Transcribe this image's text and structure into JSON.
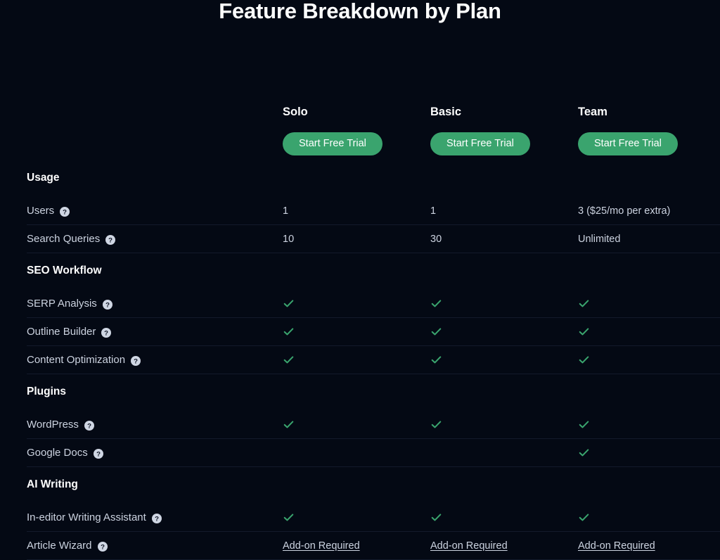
{
  "page": {
    "title": "Feature Breakdown by Plan",
    "background_color": "#040914",
    "accent_green": "#3aa46e",
    "text_color": "#ccd3e0",
    "heading_color": "#ffffff",
    "divider_color": "#131a2b"
  },
  "plans": [
    {
      "name": "Solo",
      "cta_label": "Start Free Trial"
    },
    {
      "name": "Basic",
      "cta_label": "Start Free Trial"
    },
    {
      "name": "Team",
      "cta_label": "Start Free Trial"
    }
  ],
  "help_icon": "question-mark-circle-icon",
  "check_icon": "checkmark-icon",
  "sections": [
    {
      "title": "Usage",
      "rows": [
        {
          "label": "Users",
          "has_help": true,
          "values": [
            {
              "type": "text",
              "text": "1"
            },
            {
              "type": "text",
              "text": "1"
            },
            {
              "type": "text",
              "text": "3 ($25/mo per extra)"
            }
          ]
        },
        {
          "label": "Search Queries",
          "has_help": true,
          "values": [
            {
              "type": "text",
              "text": "10"
            },
            {
              "type": "text",
              "text": "30"
            },
            {
              "type": "text",
              "text": "Unlimited"
            }
          ]
        }
      ]
    },
    {
      "title": "SEO Workflow",
      "rows": [
        {
          "label": "SERP Analysis",
          "has_help": true,
          "values": [
            {
              "type": "check"
            },
            {
              "type": "check"
            },
            {
              "type": "check"
            }
          ]
        },
        {
          "label": "Outline Builder",
          "has_help": true,
          "values": [
            {
              "type": "check"
            },
            {
              "type": "check"
            },
            {
              "type": "check"
            }
          ]
        },
        {
          "label": "Content Optimization",
          "has_help": true,
          "values": [
            {
              "type": "check"
            },
            {
              "type": "check"
            },
            {
              "type": "check"
            }
          ]
        }
      ]
    },
    {
      "title": "Plugins",
      "rows": [
        {
          "label": "WordPress",
          "has_help": true,
          "values": [
            {
              "type": "check"
            },
            {
              "type": "check"
            },
            {
              "type": "check"
            }
          ]
        },
        {
          "label": "Google Docs",
          "has_help": true,
          "values": [
            {
              "type": "empty"
            },
            {
              "type": "empty"
            },
            {
              "type": "check"
            }
          ]
        }
      ]
    },
    {
      "title": "AI Writing",
      "rows": [
        {
          "label": "In-editor Writing Assistant",
          "has_help": true,
          "values": [
            {
              "type": "check"
            },
            {
              "type": "check"
            },
            {
              "type": "check"
            }
          ]
        },
        {
          "label": "Article Wizard",
          "has_help": true,
          "values": [
            {
              "type": "link",
              "text": "Add-on Required"
            },
            {
              "type": "link",
              "text": "Add-on Required"
            },
            {
              "type": "link",
              "text": "Add-on Required"
            }
          ]
        }
      ]
    }
  ]
}
